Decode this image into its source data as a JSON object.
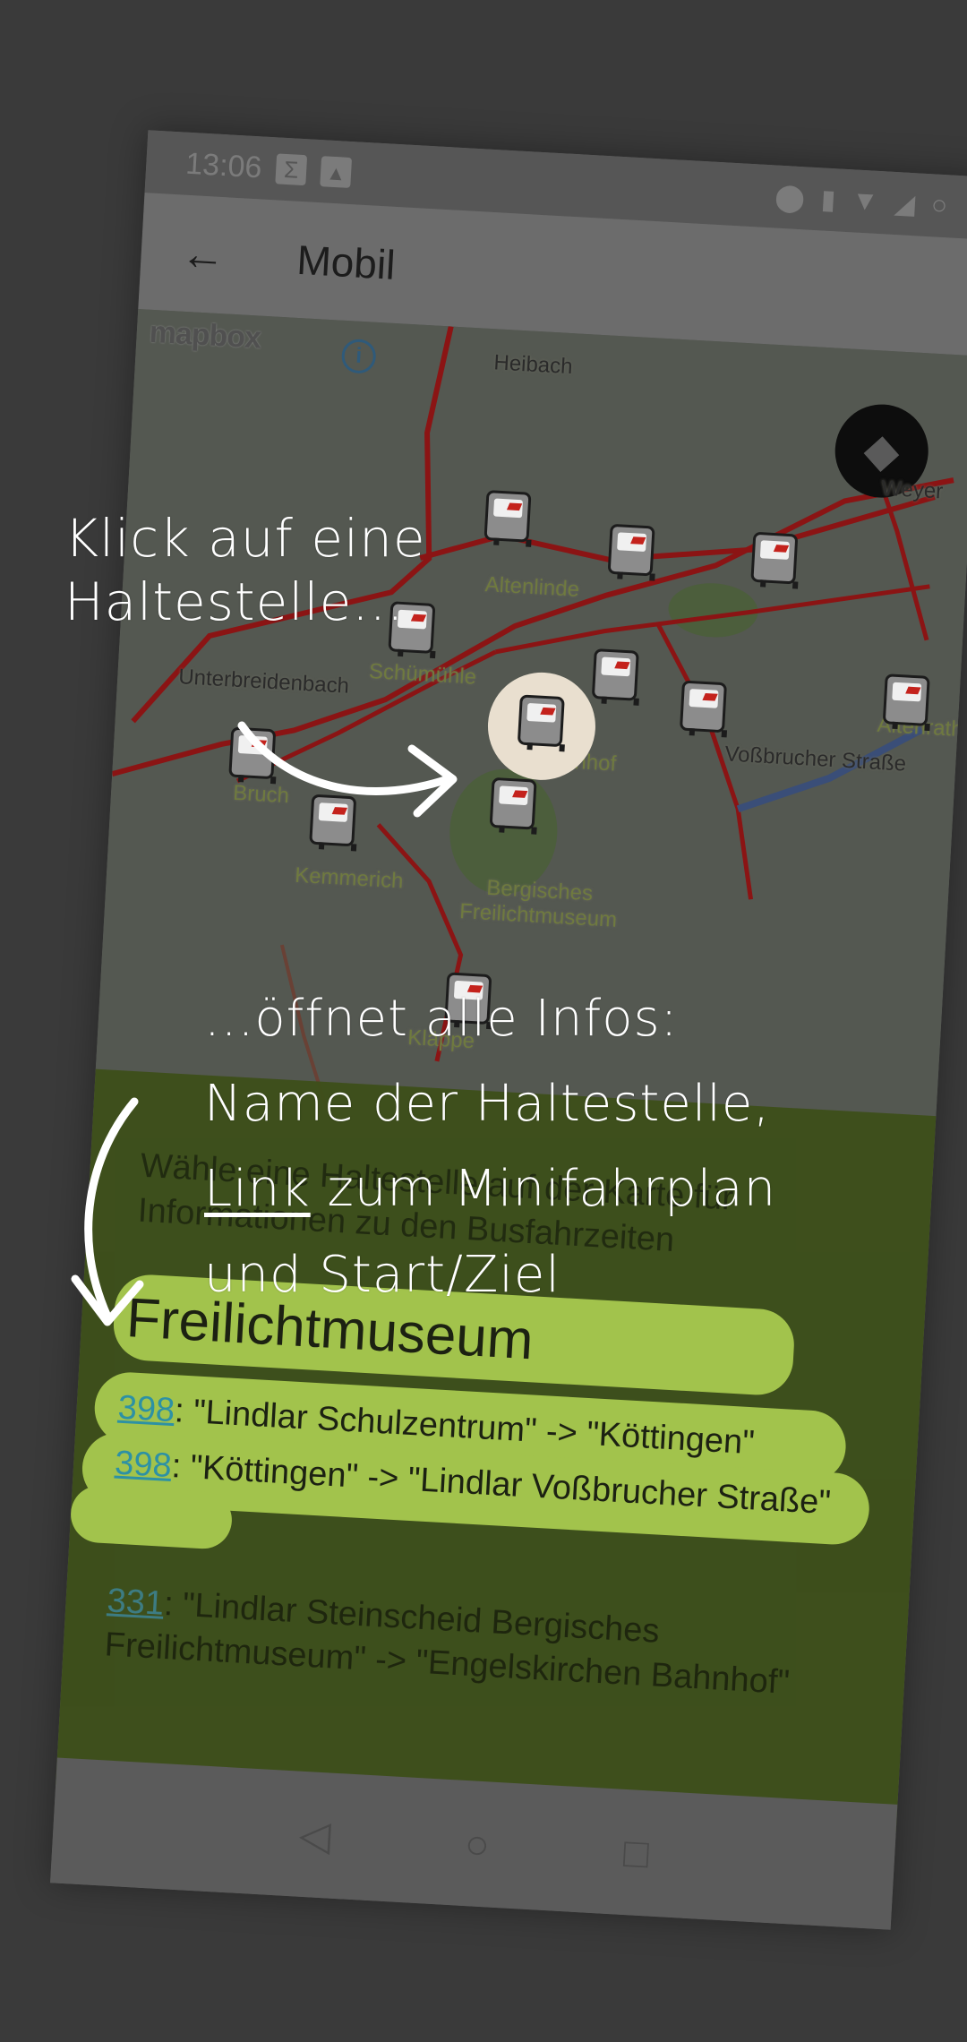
{
  "status_bar": {
    "time": "13:06",
    "icons": [
      "sigma-icon",
      "image-icon",
      "location-icon",
      "vibrate-icon",
      "wifi-icon",
      "signal-icon",
      "battery-icon"
    ]
  },
  "app_bar": {
    "back_label": "←",
    "title": "Mobil"
  },
  "map": {
    "attribution": "mapbox",
    "info_label": "i",
    "places": [
      "Heibach",
      "Weyer",
      "Altenlinde",
      "Schümühle",
      "Unterbreidenbach",
      "Falkenhof",
      "Voßbrucher Straße",
      "Altenrath",
      "Bruch",
      "Kemmerich",
      "Bergisches Freilichtmuseum",
      "Kläppe"
    ]
  },
  "annotations": {
    "top_line1": "Klick auf eine",
    "top_line2": "Haltestelle...",
    "bottom_line1": "...öffnet alle Infos:",
    "bottom_line2": "Name der Haltestelle,",
    "bottom_line3_link": "Link",
    "bottom_line3_rest": " zum Minifahrplan",
    "bottom_line4": "und Start/Ziel"
  },
  "panel": {
    "hint": "Wähle eine Haltestelle auf der Karte für Informationen zu den Busfahrzeiten",
    "stop_name": "Freilichtmuseum",
    "routes": [
      {
        "line": "398",
        "text": ": \"Lindlar Schulzentrum\" -> \"Köttingen\""
      },
      {
        "line": "398",
        "text": ": \"Köttingen\" -> \"Lindlar Voßbrucher Straße\""
      },
      {
        "line": "331",
        "text": ": \"Lindlar Steinscheid Bergisches Freilichtmuseum\" -> \"Engelskirchen Bahnhof\""
      }
    ]
  },
  "colors": {
    "highlight": "#a6c84c",
    "panel": "#3d4f1a",
    "route": "#8b1414",
    "link": "#2c94a8"
  }
}
